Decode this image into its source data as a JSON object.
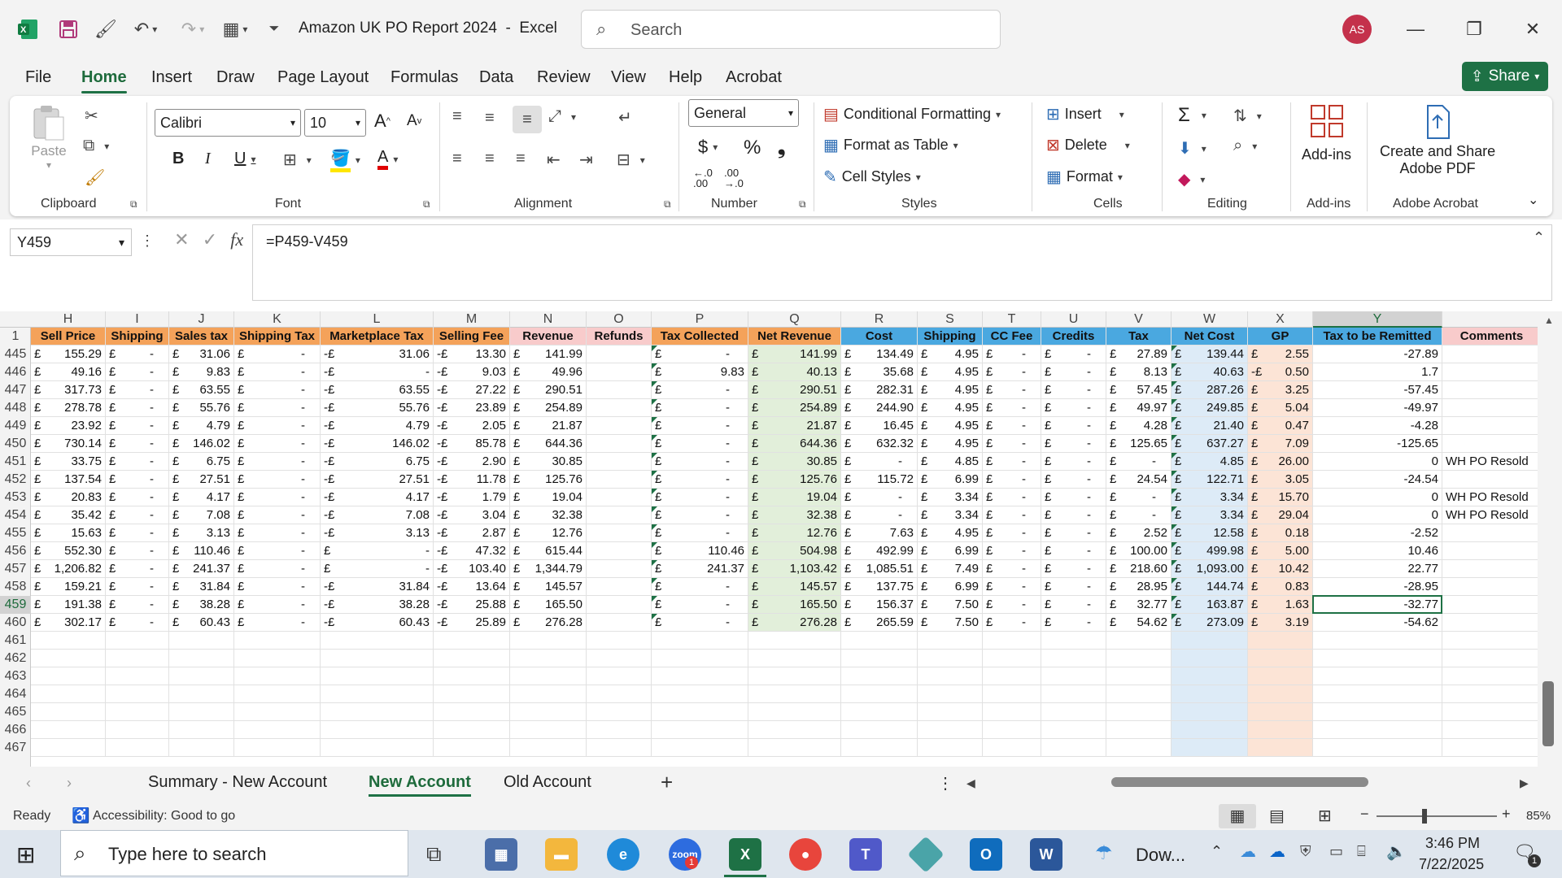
{
  "title_bar": {
    "doc_title": "Amazon UK PO Report 2024  -  Excel",
    "search_placeholder": "Search",
    "avatar_initials": "AS"
  },
  "menu_tabs": [
    "File",
    "Home",
    "Insert",
    "Draw",
    "Page Layout",
    "Formulas",
    "Data",
    "Review",
    "View",
    "Help",
    "Acrobat"
  ],
  "active_tab": "Home",
  "share_label": "Share",
  "ribbon": {
    "clipboard": {
      "paste": "Paste",
      "label": "Clipboard"
    },
    "font": {
      "name": "Calibri",
      "size": "10",
      "label": "Font"
    },
    "alignment": {
      "label": "Alignment"
    },
    "number": {
      "format": "General",
      "label": "Number"
    },
    "styles": {
      "conditional": "Conditional Formatting",
      "table": "Format as Table",
      "cell_styles": "Cell Styles",
      "label": "Styles"
    },
    "cells": {
      "insert": "Insert",
      "delete": "Delete",
      "format": "Format",
      "label": "Cells"
    },
    "editing": {
      "label": "Editing"
    },
    "addins": {
      "button": "Add-ins",
      "label": "Add-ins"
    },
    "acrobat": {
      "line1": "Create and Share",
      "line2": "Adobe PDF",
      "label": "Adobe Acrobat"
    }
  },
  "formula_bar": {
    "name_box": "Y459",
    "formula": "=P459-V459"
  },
  "grid": {
    "column_letters": [
      "H",
      "I",
      "J",
      "K",
      "L",
      "M",
      "N",
      "O",
      "P",
      "Q",
      "R",
      "S",
      "T",
      "U",
      "V",
      "W",
      "X",
      "Y"
    ],
    "header_row_number": "1",
    "headers": [
      "Sell Price",
      "Shipping",
      "Sales tax",
      "Shipping Tax",
      "Marketplace Tax",
      "Selling Fee",
      "Revenue",
      "Refunds",
      "Tax Collected",
      "Net Revenue",
      "Cost",
      "Shipping",
      "CC Fee",
      "Credits",
      "Tax",
      "Net Cost",
      "GP",
      "Tax to be Remitted",
      "Comments"
    ],
    "rows": [
      {
        "n": "445",
        "H": "155.29",
        "J": "31.06",
        "L": "31.06",
        "M": "13.30",
        "N": "141.99",
        "P": "-",
        "Q": "141.99",
        "R": "134.49",
        "S": "4.95",
        "V": "27.89",
        "W": "139.44",
        "X": "2.55",
        "Y": "-27.89",
        "Z": ""
      },
      {
        "n": "446",
        "H": "49.16",
        "J": "9.83",
        "L": "-",
        "M": "9.03",
        "N": "49.96",
        "P": "9.83",
        "Q": "40.13",
        "R": "35.68",
        "S": "4.95",
        "V": "8.13",
        "W": "40.63",
        "X": "0.50",
        "Xneg": true,
        "Y": "1.7",
        "Z": ""
      },
      {
        "n": "447",
        "H": "317.73",
        "J": "63.55",
        "L": "63.55",
        "M": "27.22",
        "N": "290.51",
        "P": "-",
        "Q": "290.51",
        "R": "282.31",
        "S": "4.95",
        "V": "57.45",
        "W": "287.26",
        "X": "3.25",
        "Y": "-57.45",
        "Z": ""
      },
      {
        "n": "448",
        "H": "278.78",
        "J": "55.76",
        "L": "55.76",
        "M": "23.89",
        "N": "254.89",
        "P": "-",
        "Q": "254.89",
        "R": "244.90",
        "S": "4.95",
        "V": "49.97",
        "W": "249.85",
        "X": "5.04",
        "Y": "-49.97",
        "Z": ""
      },
      {
        "n": "449",
        "H": "23.92",
        "J": "4.79",
        "L": "4.79",
        "M": "2.05",
        "N": "21.87",
        "P": "-",
        "Q": "21.87",
        "R": "16.45",
        "S": "4.95",
        "V": "4.28",
        "W": "21.40",
        "X": "0.47",
        "Y": "-4.28",
        "Z": ""
      },
      {
        "n": "450",
        "H": "730.14",
        "J": "146.02",
        "L": "146.02",
        "M": "85.78",
        "N": "644.36",
        "P": "-",
        "Q": "644.36",
        "R": "632.32",
        "S": "4.95",
        "V": "125.65",
        "W": "637.27",
        "X": "7.09",
        "Y": "-125.65",
        "Z": ""
      },
      {
        "n": "451",
        "H": "33.75",
        "J": "6.75",
        "L": "6.75",
        "M": "2.90",
        "N": "30.85",
        "P": "-",
        "Q": "30.85",
        "R": "-",
        "S": "4.85",
        "V": "-",
        "W": "4.85",
        "X": "26.00",
        "Y": "0",
        "Z": "WH PO Resold"
      },
      {
        "n": "452",
        "H": "137.54",
        "J": "27.51",
        "L": "27.51",
        "M": "11.78",
        "N": "125.76",
        "P": "-",
        "Q": "125.76",
        "R": "115.72",
        "S": "6.99",
        "V": "24.54",
        "W": "122.71",
        "X": "3.05",
        "Y": "-24.54",
        "Z": ""
      },
      {
        "n": "453",
        "H": "20.83",
        "J": "4.17",
        "L": "4.17",
        "M": "1.79",
        "N": "19.04",
        "P": "-",
        "Q": "19.04",
        "R": "-",
        "S": "3.34",
        "V": "-",
        "W": "3.34",
        "X": "15.70",
        "Y": "0",
        "Z": "WH PO Resold"
      },
      {
        "n": "454",
        "H": "35.42",
        "J": "7.08",
        "L": "7.08",
        "M": "3.04",
        "N": "32.38",
        "P": "-",
        "Q": "32.38",
        "R": "-",
        "S": "3.34",
        "V": "-",
        "W": "3.34",
        "X": "29.04",
        "Y": "0",
        "Z": "WH PO Resold"
      },
      {
        "n": "455",
        "H": "15.63",
        "J": "3.13",
        "L": "3.13",
        "M": "2.87",
        "N": "12.76",
        "P": "-",
        "Q": "12.76",
        "R": "7.63",
        "S": "4.95",
        "V": "2.52",
        "W": "12.58",
        "X": "0.18",
        "Y": "-2.52",
        "Z": ""
      },
      {
        "n": "456",
        "H": "552.30",
        "J": "110.46",
        "L": "-",
        "Lpos": true,
        "M": "47.32",
        "N": "615.44",
        "P": "110.46",
        "Q": "504.98",
        "R": "492.99",
        "S": "6.99",
        "V": "100.00",
        "W": "499.98",
        "X": "5.00",
        "Y": "10.46",
        "Z": ""
      },
      {
        "n": "457",
        "H": "1,206.82",
        "J": "241.37",
        "L": "-",
        "Lpos": true,
        "M": "103.40",
        "N": "1,344.79",
        "P": "241.37",
        "Q": "1,103.42",
        "R": "1,085.51",
        "S": "7.49",
        "V": "218.60",
        "W": "1,093.00",
        "X": "10.42",
        "Y": "22.77",
        "Z": ""
      },
      {
        "n": "458",
        "H": "159.21",
        "J": "31.84",
        "L": "31.84",
        "M": "13.64",
        "N": "145.57",
        "P": "-",
        "Q": "145.57",
        "R": "137.75",
        "S": "6.99",
        "V": "28.95",
        "W": "144.74",
        "X": "0.83",
        "Y": "-28.95",
        "Z": ""
      },
      {
        "n": "459",
        "H": "191.38",
        "J": "38.28",
        "L": "38.28",
        "M": "25.88",
        "N": "165.50",
        "P": "-",
        "Q": "165.50",
        "R": "156.37",
        "S": "7.50",
        "V": "32.77",
        "W": "163.87",
        "X": "1.63",
        "Y": "-32.77",
        "Z": ""
      },
      {
        "n": "460",
        "H": "302.17",
        "J": "60.43",
        "L": "60.43",
        "M": "25.89",
        "N": "276.28",
        "P": "-",
        "Q": "276.28",
        "R": "265.59",
        "S": "7.50",
        "V": "54.62",
        "W": "273.09",
        "X": "3.19",
        "Y": "-54.62",
        "Z": ""
      }
    ],
    "empty_rows": [
      "461",
      "462",
      "463",
      "464",
      "465",
      "466",
      "467"
    ],
    "currency": "£",
    "dash": "-",
    "neg_currency": "-£",
    "selected_row": "459",
    "selected_column": "Y"
  },
  "sheet_tabs": [
    "Summary - New Account",
    "New Account",
    "Old Account"
  ],
  "active_sheet": "New Account",
  "status": {
    "ready": "Ready",
    "accessibility": "Accessibility: Good to go",
    "zoom": "85%"
  },
  "taskbar": {
    "search_placeholder": "Type here to search",
    "weather": "Dow...",
    "time": "3:46 PM",
    "date": "7/22/2025",
    "notification_count": "1",
    "zoom_badge": "1"
  },
  "colors": {
    "excel_green": "#1e7145",
    "header_orange": "#f4a25a",
    "header_pink": "#f8cbcb",
    "header_green": "#92d050",
    "header_blue": "#4aa8e0",
    "net_revenue_fill": "#e2efda",
    "net_cost_fill": "#ddebf7",
    "gp_fill": "#fce4d6"
  }
}
